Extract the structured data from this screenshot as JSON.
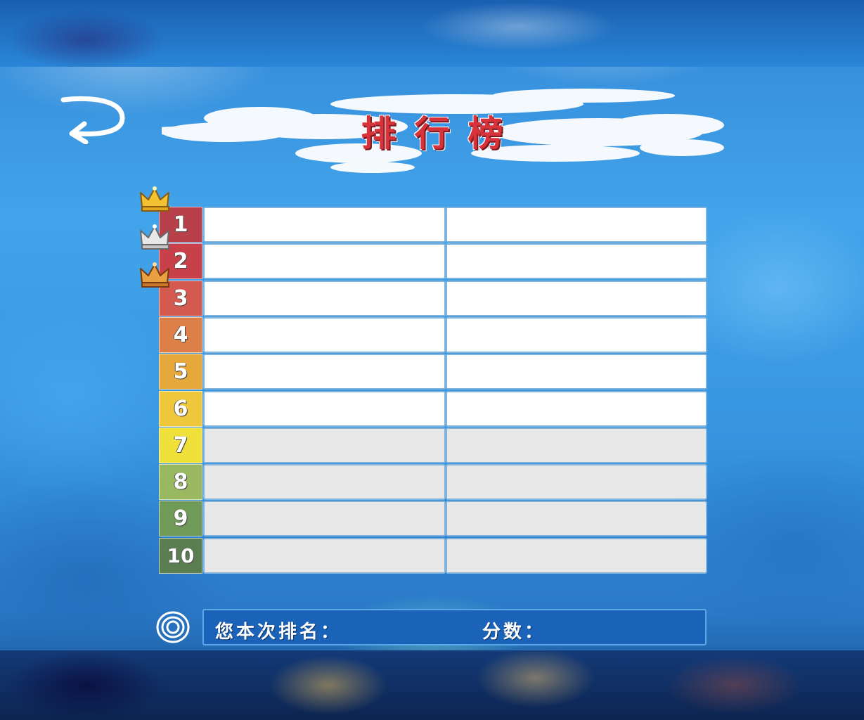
{
  "title": "排行榜",
  "back_button": {
    "icon": "return-arrow-icon"
  },
  "leaderboard": {
    "rows": [
      {
        "rank": "1",
        "name": "",
        "score": "",
        "color": "#b8404a",
        "crown": "gold-crown-icon"
      },
      {
        "rank": "2",
        "name": "",
        "score": "",
        "color": "#c8404a",
        "crown": "silver-crown-icon"
      },
      {
        "rank": "3",
        "name": "",
        "score": "",
        "color": "#d45a50",
        "crown": "bronze-crown-icon"
      },
      {
        "rank": "4",
        "name": "",
        "score": "",
        "color": "#dc7f48",
        "crown": ""
      },
      {
        "rank": "5",
        "name": "",
        "score": "",
        "color": "#e6a83a",
        "crown": ""
      },
      {
        "rank": "6",
        "name": "",
        "score": "",
        "color": "#eec83a",
        "crown": ""
      },
      {
        "rank": "7",
        "name": "",
        "score": "",
        "color": "#f0e03a",
        "crown": ""
      },
      {
        "rank": "8",
        "name": "",
        "score": "",
        "color": "#9ab860",
        "crown": ""
      },
      {
        "rank": "9",
        "name": "",
        "score": "",
        "color": "#6f9a58",
        "crown": ""
      },
      {
        "rank": "10",
        "name": "",
        "score": "",
        "color": "#5a7e50",
        "crown": ""
      }
    ]
  },
  "footer": {
    "icon": "swirl-icon",
    "rank_label": "您本次排名：",
    "score_label": "分数："
  },
  "colors": {
    "title": "#d8323a",
    "footer_bar": "#1a63b8",
    "cell_border": "#7fb2dc"
  }
}
